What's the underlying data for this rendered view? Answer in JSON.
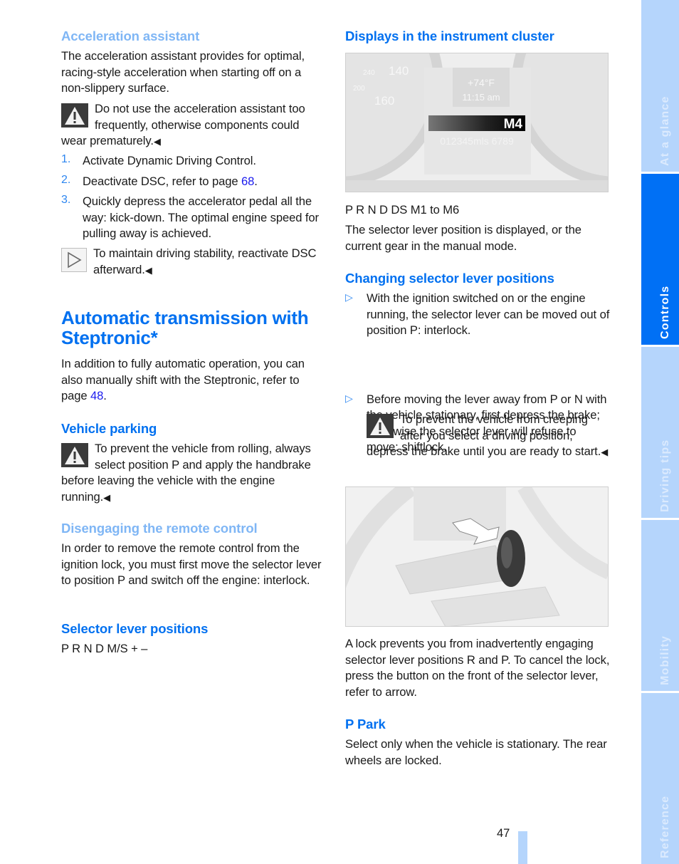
{
  "left_column": {
    "acceleration_assistant": {
      "heading": "Acceleration assistant",
      "intro": "The acceleration assistant provides for optimal, racing-style acceleration when starting off on a non-slippery surface.",
      "warning": "Do not use the acceleration assistant too frequently, otherwise components could wear prematurely.",
      "steps": [
        {
          "number": "1.",
          "text": "Activate Dynamic Driving Control."
        },
        {
          "number": "2.",
          "text_before": "Deactivate DSC, refer to page ",
          "link": "68",
          "text_after": "."
        },
        {
          "number": "3.",
          "text": "Quickly depress the accelerator pedal all the way: kick-down. The optimal engine speed for pulling away is achieved."
        }
      ],
      "note": "To maintain driving stability, reactivate DSC afterward."
    },
    "automatic_transmission": {
      "heading": "Automatic transmission with Steptronic*",
      "intro_before": "In addition to fully automatic operation, you can also manually shift with the Steptronic, refer to page ",
      "intro_link": "48",
      "intro_after": "."
    },
    "vehicle_parking": {
      "heading": "Vehicle parking",
      "warning": "To prevent the vehicle from rolling, always select position P and apply the handbrake before leaving the vehicle with the engine running."
    },
    "disengaging_remote": {
      "heading": "Disengaging the remote control",
      "text": "In order to remove the remote control from the ignition lock, you must first move the selector lever to position P and switch off the engine: interlock."
    },
    "selector_positions": {
      "heading": "Selector lever positions",
      "text": "P R N D M/S + –"
    }
  },
  "right_column": {
    "instrument_cluster": {
      "heading": "Displays in the instrument cluster",
      "figure": {
        "speed_labels": [
          "140",
          "160",
          "240",
          "200"
        ],
        "temperature": "+74°F",
        "time": "11:15 am",
        "gear": "M4",
        "odometer": "012345mls 6789"
      },
      "positions": "P R N D DS M1 to M6",
      "text": "The selector lever position is displayed, or the current gear in the manual mode."
    },
    "changing_positions": {
      "heading": "Changing selector lever positions",
      "bullets": [
        "With the ignition switched on or the engine running, the selector lever can be moved out of position P: interlock.",
        "Before moving the lever away from P or N with the vehicle stationary, first depress the brake; otherwise the selector lever will refuse to move: shiftlock."
      ],
      "warning": "To prevent the vehicle from creeping after you select a driving position, depress the brake until you are ready to start.",
      "lock_text": "A lock prevents you from inadvertently engaging selector lever positions R and P. To cancel the lock, press the button on the front of the selector lever, refer to arrow."
    },
    "p_park": {
      "heading": "P Park",
      "text": "Select only when the vehicle is stationary. The rear wheels are locked."
    }
  },
  "end_mark": "◀",
  "bullet_glyph": "▷",
  "page_number": "47",
  "sidebar": {
    "tabs": [
      {
        "label": "At a glance",
        "active": false
      },
      {
        "label": "Controls",
        "active": true
      },
      {
        "label": "Driving tips",
        "active": false
      },
      {
        "label": "Mobility",
        "active": false
      },
      {
        "label": "Reference",
        "active": false
      }
    ]
  },
  "colors": {
    "heading_blue": "#0070f0",
    "heading_light_blue": "#7fb6f5",
    "link_blue": "#1a1aee",
    "tab_active": "#0070f5",
    "tab_inactive": "#b5d5fc"
  }
}
